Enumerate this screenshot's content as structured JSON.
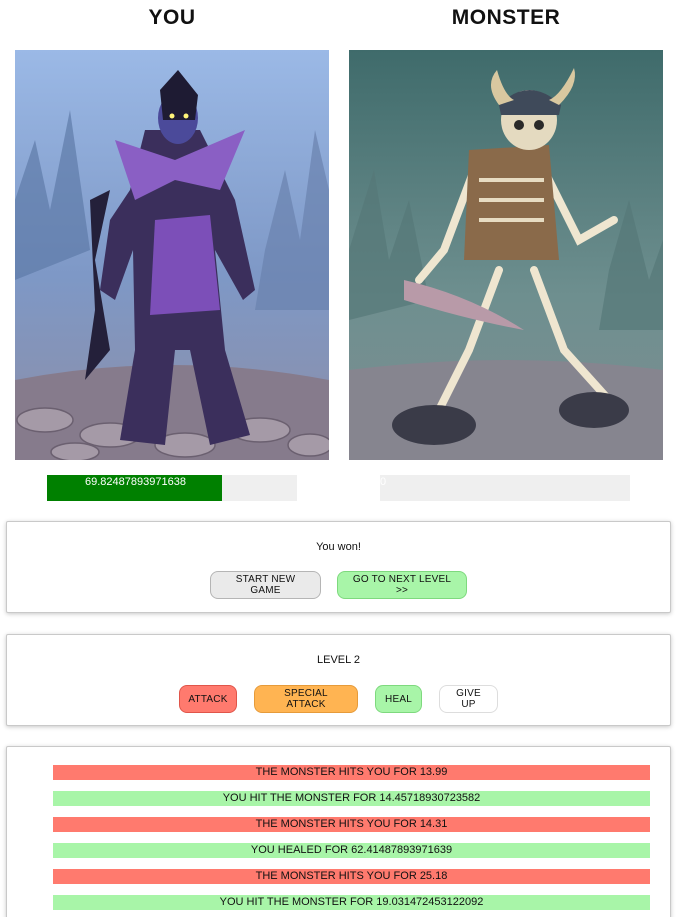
{
  "players": {
    "you": {
      "title": "YOU",
      "health_text": "69.82487893971638",
      "health_percent": 69.82487893971638
    },
    "monster": {
      "title": "MONSTER",
      "health_text": "0",
      "health_percent": 0
    }
  },
  "result": {
    "message": "You won!",
    "start_new_label": "START NEW GAME",
    "next_level_label": "GO TO NEXT LEVEL >>"
  },
  "controls": {
    "level_label": "LEVEL 2",
    "attack_label": "ATTACK",
    "special_attack_label": "SPECIAL ATTACK",
    "heal_label": "HEAL",
    "give_up_label": "GIVE UP"
  },
  "battle_log": [
    {
      "actor": "monster",
      "text": "THE MONSTER HITS YOU FOR 13.99"
    },
    {
      "actor": "player",
      "text": "YOU HIT THE MONSTER FOR 14.45718930723582"
    },
    {
      "actor": "monster",
      "text": "THE MONSTER HITS YOU FOR 14.31"
    },
    {
      "actor": "player",
      "text": "YOU HEALED FOR 62.41487893971639"
    },
    {
      "actor": "monster",
      "text": "THE MONSTER HITS YOU FOR 25.18"
    },
    {
      "actor": "player",
      "text": "YOU HIT THE MONSTER FOR 19.031472453122092"
    }
  ],
  "colors": {
    "health_fill": "#008000",
    "monster_entry": "#ff7a6e",
    "player_entry": "#a8f5a8",
    "attack": "#ff7a6e",
    "special": "#ffb452",
    "heal": "#a8f5a8"
  },
  "images": {
    "you": "purple-armored-elf-warrior",
    "monster": "horned-helmet-skeleton-with-dagger"
  }
}
